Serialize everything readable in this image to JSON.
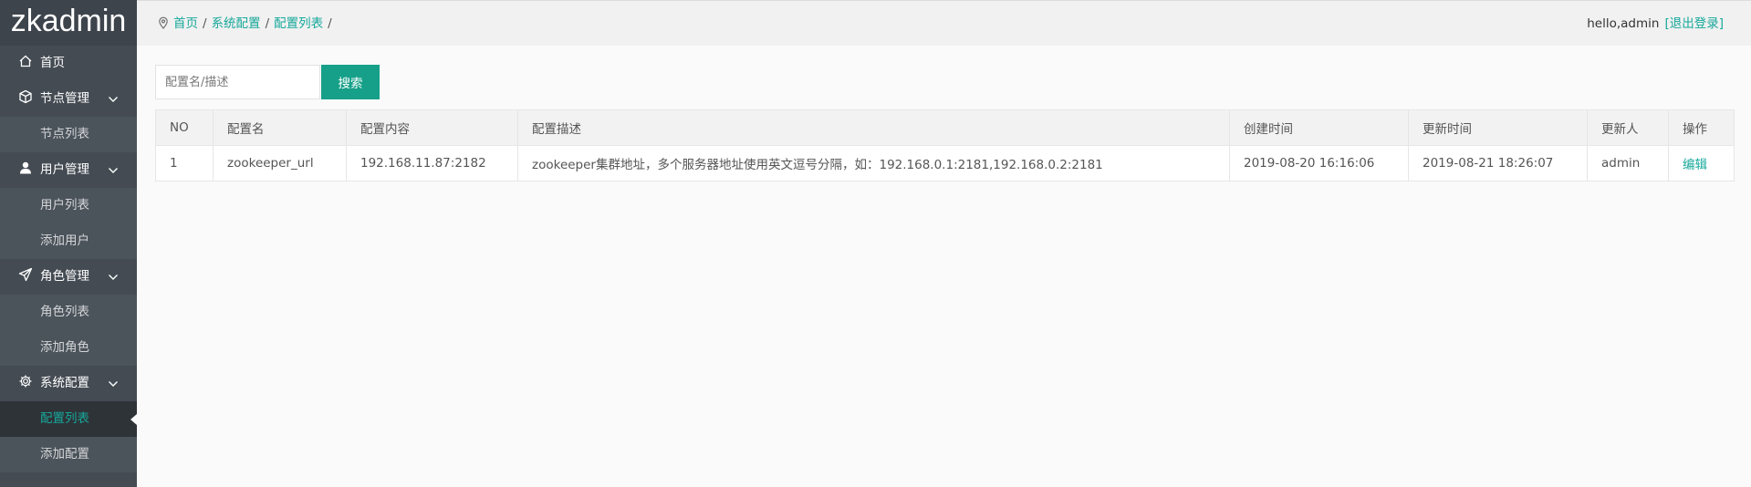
{
  "app": {
    "logo": "zkadmin"
  },
  "sidebar": {
    "home": "首页",
    "groups": [
      {
        "label": "节点管理",
        "icon": "cube-icon",
        "items": [
          "节点列表"
        ]
      },
      {
        "label": "用户管理",
        "icon": "user-icon",
        "items": [
          "用户列表",
          "添加用户"
        ]
      },
      {
        "label": "角色管理",
        "icon": "paper-plane-icon",
        "items": [
          "角色列表",
          "添加角色"
        ]
      },
      {
        "label": "系统配置",
        "icon": "gear-icon",
        "items": [
          "配置列表",
          "添加配置"
        ]
      }
    ],
    "active_item": "配置列表"
  },
  "breadcrumb": {
    "items": [
      "首页",
      "系统配置",
      "配置列表"
    ],
    "separator": "/"
  },
  "user": {
    "greeting": "hello,admin",
    "logout": "[退出登录]"
  },
  "search": {
    "placeholder": "配置名/描述",
    "value": "",
    "button": "搜索"
  },
  "table": {
    "columns": [
      "NO",
      "配置名",
      "配置内容",
      "配置描述",
      "创建时间",
      "更新时间",
      "更新人",
      "操作"
    ],
    "rows": [
      {
        "no": "1",
        "name": "zookeeper_url",
        "content": "192.168.11.87:2182",
        "desc": "zookeeper集群地址，多个服务器地址使用英文逗号分隔，如：192.168.0.1:2181,192.168.0.2:2181",
        "created": "2019-08-20 16:16:06",
        "updated": "2019-08-21 18:26:07",
        "updater": "admin",
        "action": "编辑"
      }
    ]
  },
  "colors": {
    "accent": "#16a89a",
    "sidebar_bg": "#444b53",
    "sidebar_active_bg": "#2e3338",
    "button_bg": "#16a089"
  }
}
